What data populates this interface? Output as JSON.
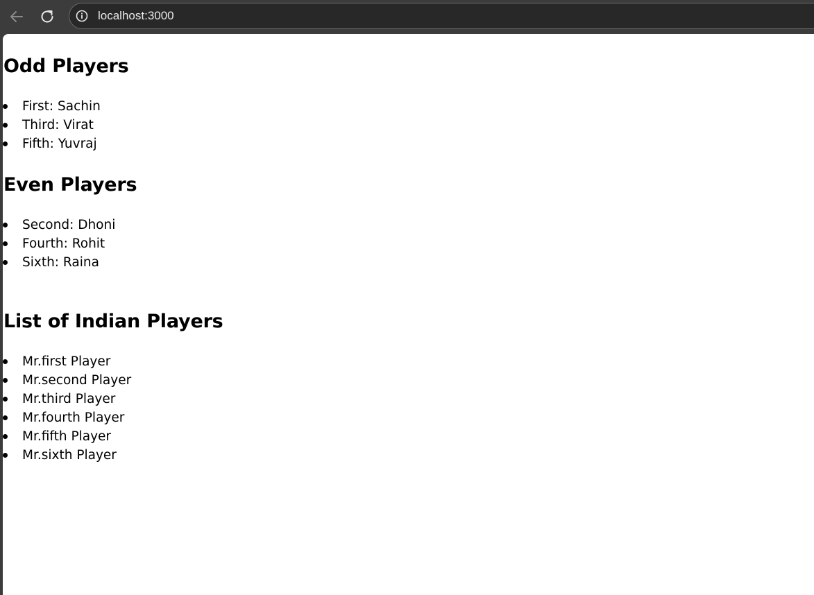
{
  "browser": {
    "url": "localhost:3000"
  },
  "odd": {
    "title": "Odd Players",
    "items": [
      "First: Sachin",
      "Third: Virat",
      "Fifth: Yuvraj"
    ]
  },
  "even": {
    "title": "Even Players",
    "items": [
      "Second: Dhoni",
      "Fourth: Rohit",
      "Sixth: Raina"
    ]
  },
  "indian": {
    "title": "List of Indian Players",
    "items": [
      "Mr.first Player",
      "Mr.second Player",
      "Mr.third Player",
      "Mr.fourth Player",
      "Mr.fifth Player",
      "Mr.sixth Player"
    ]
  }
}
